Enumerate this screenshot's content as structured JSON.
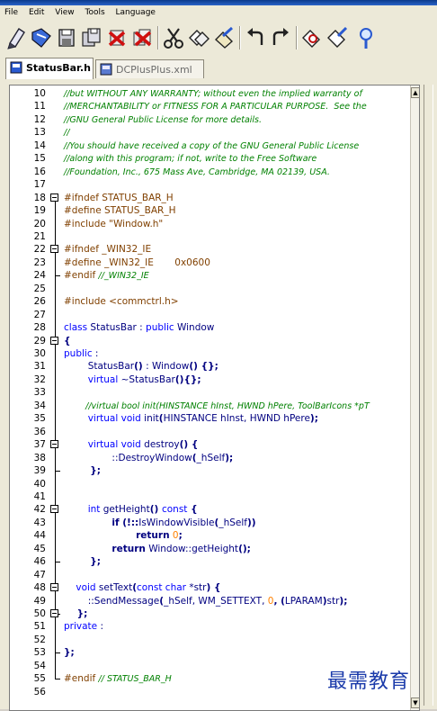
{
  "menu": {
    "items": [
      "File",
      "Edit",
      "View",
      "Tools",
      "Language"
    ]
  },
  "toolbar": {
    "buttons": [
      "new-file-icon",
      "open-file-icon",
      "save-icon",
      "save-all-icon",
      "close-icon",
      "close-all-icon",
      "cut-icon",
      "copy-icon",
      "paste-icon",
      "undo-icon",
      "redo-icon",
      "find-icon",
      "replace-icon",
      "zoom-icon"
    ]
  },
  "tabs": [
    {
      "label": "StatusBar.h",
      "active": true
    },
    {
      "label": "DCPlusPlus.xml",
      "active": false
    }
  ],
  "editor": {
    "lines": [
      {
        "n": "10",
        "parts": [
          {
            "t": "//but WITHOUT ANY WARRANTY; without even the implied warranty of",
            "c": "comment"
          }
        ]
      },
      {
        "n": "11",
        "parts": [
          {
            "t": "//MERCHANTABILITY or FITNESS FOR A PARTICULAR PURPOSE.  See the",
            "c": "comment"
          }
        ]
      },
      {
        "n": "12",
        "parts": [
          {
            "t": "//GNU General Public License for more details.",
            "c": "comment"
          }
        ]
      },
      {
        "n": "13",
        "parts": [
          {
            "t": "//",
            "c": "comment"
          }
        ]
      },
      {
        "n": "14",
        "parts": [
          {
            "t": "//You should have received a copy of the GNU General Public License",
            "c": "comment"
          }
        ]
      },
      {
        "n": "15",
        "parts": [
          {
            "t": "//along with this program; if not, write to the Free Software",
            "c": "comment"
          }
        ]
      },
      {
        "n": "16",
        "parts": [
          {
            "t": "//Foundation, Inc., 675 Mass Ave, Cambridge, MA 02139, USA.",
            "c": "comment"
          }
        ]
      },
      {
        "n": "17",
        "parts": []
      },
      {
        "n": "18",
        "parts": [
          {
            "t": "#ifndef STATUS_BAR_H",
            "c": "pre"
          }
        ]
      },
      {
        "n": "19",
        "parts": [
          {
            "t": "#define STATUS_BAR_H",
            "c": "pre"
          }
        ]
      },
      {
        "n": "20",
        "parts": [
          {
            "t": "#include \"Window.h\"",
            "c": "pre"
          }
        ]
      },
      {
        "n": "21",
        "parts": []
      },
      {
        "n": "22",
        "parts": [
          {
            "t": "#ifndef _WIN32_IE",
            "c": "pre"
          }
        ]
      },
      {
        "n": "23",
        "parts": [
          {
            "t": "#define _WIN32_IE       0x0600",
            "c": "pre"
          }
        ]
      },
      {
        "n": "24",
        "parts": [
          {
            "t": "#endif ",
            "c": "pre"
          },
          {
            "t": "//_WIN32_IE",
            "c": "comment"
          }
        ]
      },
      {
        "n": "25",
        "parts": []
      },
      {
        "n": "26",
        "parts": [
          {
            "t": "#include <commctrl.h>",
            "c": "pre"
          }
        ]
      },
      {
        "n": "27",
        "parts": []
      },
      {
        "n": "28",
        "parts": [
          {
            "t": "class",
            "c": "kw"
          },
          {
            "t": " StatusBar : ",
            "c": "norm"
          },
          {
            "t": "public",
            "c": "kw"
          },
          {
            "t": " Window",
            "c": "norm"
          }
        ]
      },
      {
        "n": "29",
        "parts": [
          {
            "t": "{",
            "c": "bold"
          }
        ]
      },
      {
        "n": "30",
        "parts": [
          {
            "t": "public",
            "c": "kw"
          },
          {
            "t": " :",
            "c": "norm"
          }
        ]
      },
      {
        "n": "31",
        "parts": [
          {
            "t": "        StatusBar",
            "c": "norm"
          },
          {
            "t": "()",
            "c": "bold"
          },
          {
            "t": " : Window",
            "c": "norm"
          },
          {
            "t": "() {};",
            "c": "bold"
          }
        ]
      },
      {
        "n": "32",
        "parts": [
          {
            "t": "        ",
            "c": "norm"
          },
          {
            "t": "virtual",
            "c": "kw"
          },
          {
            "t": " ~StatusBar",
            "c": "norm"
          },
          {
            "t": "(){};",
            "c": "bold"
          }
        ]
      },
      {
        "n": "33",
        "parts": []
      },
      {
        "n": "34",
        "parts": [
          {
            "t": "        //virtual bool init(HINSTANCE hInst, HWND hPere, ToolBarIcons *pT",
            "c": "comment"
          }
        ]
      },
      {
        "n": "35",
        "parts": [
          {
            "t": "        ",
            "c": "norm"
          },
          {
            "t": "virtual void",
            "c": "kw"
          },
          {
            "t": " init",
            "c": "norm"
          },
          {
            "t": "(",
            "c": "bold"
          },
          {
            "t": "HINSTANCE hInst, HWND hPere",
            "c": "norm"
          },
          {
            "t": ");",
            "c": "bold"
          }
        ]
      },
      {
        "n": "36",
        "parts": []
      },
      {
        "n": "37",
        "parts": [
          {
            "t": "        ",
            "c": "norm"
          },
          {
            "t": "virtual void",
            "c": "kw"
          },
          {
            "t": " destroy",
            "c": "norm"
          },
          {
            "t": "() {",
            "c": "bold"
          }
        ]
      },
      {
        "n": "38",
        "parts": [
          {
            "t": "                ::DestroyWindow",
            "c": "norm"
          },
          {
            "t": "(",
            "c": "bold"
          },
          {
            "t": "_hSelf",
            "c": "norm"
          },
          {
            "t": ");",
            "c": "bold"
          }
        ]
      },
      {
        "n": "39",
        "parts": [
          {
            "t": "        };",
            "c": "bold"
          }
        ]
      },
      {
        "n": "40",
        "parts": []
      },
      {
        "n": "41",
        "parts": []
      },
      {
        "n": "42",
        "parts": [
          {
            "t": "        ",
            "c": "norm"
          },
          {
            "t": "int",
            "c": "kw"
          },
          {
            "t": " getHeight",
            "c": "norm"
          },
          {
            "t": "() ",
            "c": "bold"
          },
          {
            "t": "const",
            "c": "kw"
          },
          {
            "t": " {",
            "c": "bold"
          }
        ]
      },
      {
        "n": "43",
        "parts": [
          {
            "t": "                ",
            "c": "norm"
          },
          {
            "t": "if",
            "c": "bold"
          },
          {
            "t": " (!::",
            "c": "bold"
          },
          {
            "t": "IsWindowVisible",
            "c": "norm"
          },
          {
            "t": "(",
            "c": "bold"
          },
          {
            "t": "_hSelf",
            "c": "norm"
          },
          {
            "t": "))",
            "c": "bold"
          }
        ]
      },
      {
        "n": "44",
        "parts": [
          {
            "t": "                        ",
            "c": "norm"
          },
          {
            "t": "return",
            "c": "bold"
          },
          {
            "t": " ",
            "c": "norm"
          },
          {
            "t": "0",
            "c": "num"
          },
          {
            "t": ";",
            "c": "bold"
          }
        ]
      },
      {
        "n": "45",
        "parts": [
          {
            "t": "                ",
            "c": "norm"
          },
          {
            "t": "return",
            "c": "bold"
          },
          {
            "t": " Window::getHeight",
            "c": "norm"
          },
          {
            "t": "();",
            "c": "bold"
          }
        ]
      },
      {
        "n": "46",
        "parts": [
          {
            "t": "        };",
            "c": "bold"
          }
        ]
      },
      {
        "n": "47",
        "parts": []
      },
      {
        "n": "48",
        "parts": [
          {
            "t": "    ",
            "c": "norm"
          },
          {
            "t": "void",
            "c": "kw"
          },
          {
            "t": " setText",
            "c": "norm"
          },
          {
            "t": "(",
            "c": "bold"
          },
          {
            "t": "const char",
            "c": "kw"
          },
          {
            "t": " *str",
            "c": "norm"
          },
          {
            "t": ") {",
            "c": "bold"
          }
        ]
      },
      {
        "n": "49",
        "parts": [
          {
            "t": "        ::SendMessage",
            "c": "norm"
          },
          {
            "t": "(",
            "c": "bold"
          },
          {
            "t": "_hSelf, WM_SETTEXT, ",
            "c": "norm"
          },
          {
            "t": "0",
            "c": "num"
          },
          {
            "t": ", (",
            "c": "bold"
          },
          {
            "t": "LPARAM",
            "c": "norm"
          },
          {
            "t": ")",
            "c": "bold"
          },
          {
            "t": "str",
            "c": "norm"
          },
          {
            "t": ");",
            "c": "bold"
          }
        ]
      },
      {
        "n": "50",
        "parts": [
          {
            "t": "    };",
            "c": "bold"
          }
        ]
      },
      {
        "n": "51",
        "parts": [
          {
            "t": "private",
            "c": "kw"
          },
          {
            "t": " :",
            "c": "norm"
          }
        ]
      },
      {
        "n": "52",
        "parts": []
      },
      {
        "n": "53",
        "parts": [
          {
            "t": "};",
            "c": "bold"
          }
        ]
      },
      {
        "n": "54",
        "parts": []
      },
      {
        "n": "55",
        "parts": [
          {
            "t": "#endif ",
            "c": "pre"
          },
          {
            "t": "// STATUS_BAR_H",
            "c": "comment"
          }
        ]
      },
      {
        "n": "56",
        "parts": []
      }
    ]
  },
  "watermark": {
    "text": "最需教育"
  }
}
